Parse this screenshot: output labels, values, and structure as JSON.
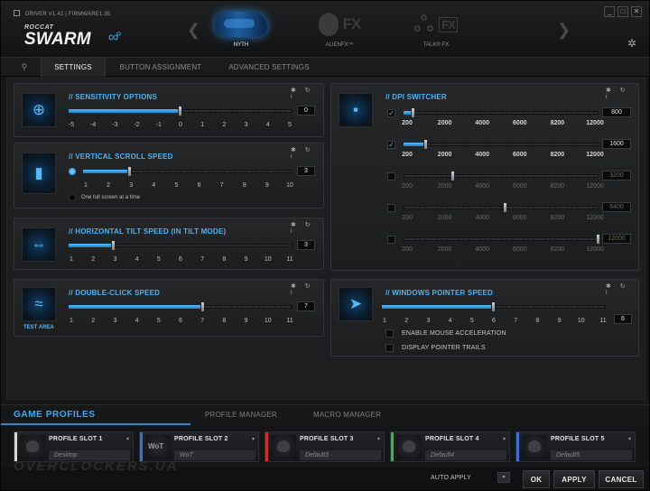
{
  "header": {
    "version_label": "DRIVER V1.42 | FIRMWARE1.35",
    "logo_top": "ROCCAT",
    "logo_main": "SWARM",
    "logo_dots": "∞°",
    "devices": [
      {
        "label": "NYTH",
        "icon": "mouse-icon"
      },
      {
        "label": "ALIENFX™",
        "icon": "alien-icon",
        "badge": "FX"
      },
      {
        "label": "TALK® FX",
        "icon": "talk-fx-icon",
        "badge": "FX"
      }
    ],
    "prev_arrow": "❮",
    "next_arrow": "❯",
    "window_buttons": [
      "_",
      "□",
      "✕"
    ],
    "gear": "✲",
    "tag": ""
  },
  "tabs": {
    "pin": "⚲",
    "items": [
      "SETTINGS",
      "BUTTON ASSIGNMENT",
      "ADVANCED SETTINGS"
    ]
  },
  "panel_tools": "✱ ↻ i",
  "sensitivity": {
    "title": "// SENSITIVITY OPTIONS",
    "ticks": [
      "-5",
      "-4",
      "-3",
      "-2",
      "-1",
      "0",
      "1",
      "2",
      "3",
      "4",
      "5"
    ],
    "value": "0",
    "fraction": 0.5
  },
  "vertical_scroll": {
    "title": "// VERTICAL SCROLL SPEED",
    "ticks": [
      "1",
      "2",
      "3",
      "4",
      "5",
      "6",
      "7",
      "8",
      "9",
      "10"
    ],
    "value": "3",
    "fraction": 0.2222,
    "option_label": "One full screen at a time"
  },
  "horizontal_tilt": {
    "title": "// HORIZONTAL TILT SPEED (IN TILT MODE)",
    "ticks": [
      "1",
      "2",
      "3",
      "4",
      "5",
      "6",
      "7",
      "8",
      "9",
      "10",
      "11"
    ],
    "value": "3",
    "fraction": 0.2
  },
  "double_click": {
    "title": "// DOUBLE-CLICK SPEED",
    "ticks": [
      "1",
      "2",
      "3",
      "4",
      "5",
      "6",
      "7",
      "8",
      "9",
      "10",
      "11"
    ],
    "value": "7",
    "fraction": 0.6,
    "test_area": "TEST AREA"
  },
  "dpi": {
    "title": "// DPI SWITCHER",
    "ticks": [
      "200",
      "2000",
      "4000",
      "6000",
      "8200",
      "12000"
    ],
    "levels": [
      {
        "checked": true,
        "value": "800",
        "fraction": 0.05
      },
      {
        "checked": true,
        "value": "1600",
        "fraction": 0.118
      },
      {
        "checked": false,
        "value": "3200",
        "fraction": 0.254
      },
      {
        "checked": false,
        "value": "6400",
        "fraction": 0.525
      },
      {
        "checked": false,
        "value": "12000",
        "fraction": 1.0
      }
    ]
  },
  "pointer": {
    "title": "// WINDOWS POINTER SPEED",
    "ticks": [
      "1",
      "2",
      "3",
      "4",
      "5",
      "6",
      "7",
      "8",
      "9",
      "10",
      "11"
    ],
    "value": "6",
    "fraction": 0.5,
    "options": [
      "ENABLE MOUSE ACCELERATION",
      "DISPLAY POINTER TRAILS"
    ]
  },
  "game_profiles": {
    "title": "GAME PROFILES",
    "tabs": [
      "PROFILE MANAGER",
      "MACRO MANAGER"
    ],
    "slots": [
      {
        "name": "PROFILE SLOT 1",
        "game": "Desktop",
        "color": "#d8d8d8"
      },
      {
        "name": "PROFILE SLOT 2",
        "game": "WoT",
        "color": "#2f74d6"
      },
      {
        "name": "PROFILE SLOT 3",
        "game": "Default3",
        "color": "#d52b2b"
      },
      {
        "name": "PROFILE SLOT 4",
        "game": "Default4",
        "color": "#2fbf3a"
      },
      {
        "name": "PROFILE SLOT 5",
        "game": "Default5",
        "color": "#3f6fd6"
      }
    ]
  },
  "footer": {
    "watermark": "OVERCLOCKERS.UA",
    "auto_apply": "AUTO APPLY",
    "buttons": [
      "OK",
      "APPLY",
      "CANCEL"
    ]
  },
  "colors": {
    "accent": "#4fb1f1",
    "background": "#161719"
  }
}
